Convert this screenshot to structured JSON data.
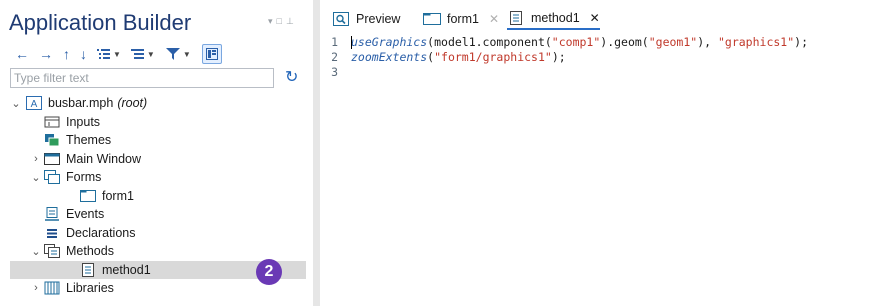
{
  "left": {
    "title": "Application Builder",
    "filter": {
      "placeholder": "Type filter text",
      "value": ""
    },
    "tree": [
      {
        "label": "busbar.mph",
        "suffix": "(root)"
      },
      {
        "label": "Inputs"
      },
      {
        "label": "Themes"
      },
      {
        "label": "Main Window"
      },
      {
        "label": "Forms"
      },
      {
        "label": "form1"
      },
      {
        "label": "Events"
      },
      {
        "label": "Declarations"
      },
      {
        "label": "Methods"
      },
      {
        "label": "method1"
      },
      {
        "label": "Libraries"
      }
    ],
    "badge": "2"
  },
  "tabs": [
    {
      "label": "Preview"
    },
    {
      "label": "form1"
    },
    {
      "label": "method1"
    }
  ],
  "editor": {
    "lines": [
      {
        "num": "1",
        "fn": "useGraphics",
        "a": "(model1.component(",
        "s1": "\"comp1\"",
        "b": ").geom(",
        "s2": "\"geom1\"",
        "c": "), ",
        "s3": "\"graphics1\"",
        "d": ");"
      },
      {
        "num": "2",
        "fn": "zoomExtents",
        "a": "(",
        "s1": "\"form1/graphics1\"",
        "b": ");"
      },
      {
        "num": "3"
      }
    ]
  },
  "colors": {
    "title": "#1f3b73",
    "accent": "#2a6ec7",
    "badge": "#6a39b5",
    "string": "#c0392b",
    "keyword": "#2b5fa8"
  }
}
